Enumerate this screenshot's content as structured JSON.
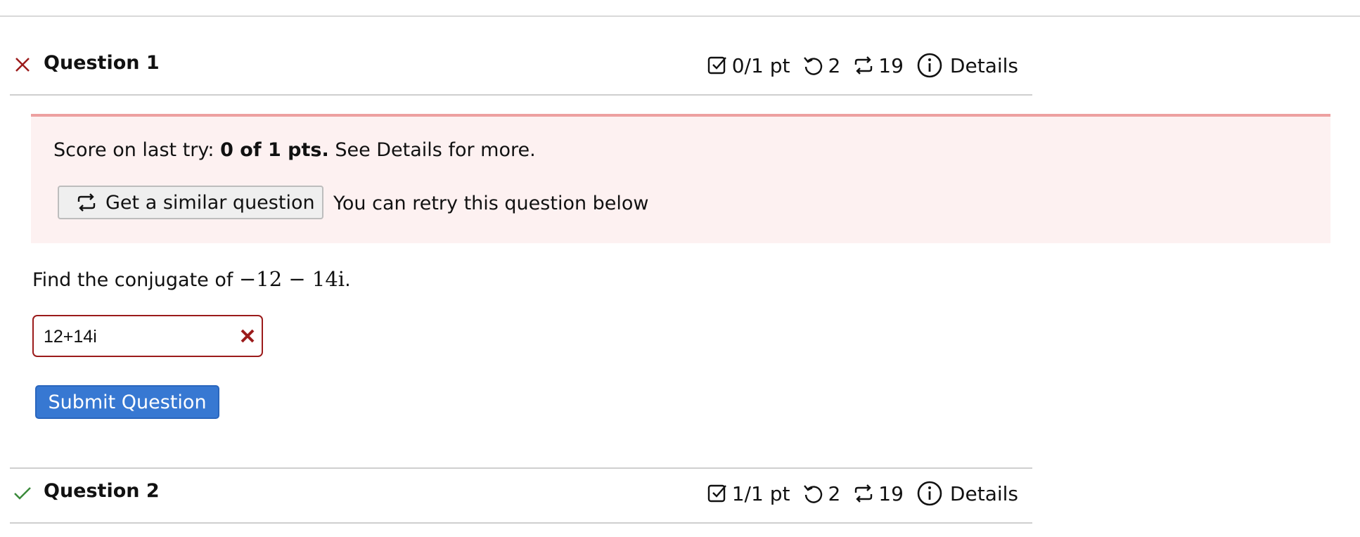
{
  "questions": [
    {
      "title": "Question 1",
      "status": "incorrect",
      "status_icon": "x-icon",
      "status_color": "#9b1b1b",
      "score": "0/1 pt",
      "retries": "2",
      "similar_count": "19",
      "details_label": "Details"
    },
    {
      "title": "Question 2",
      "status": "correct",
      "status_icon": "check-icon",
      "status_color": "#3b8a3b",
      "score": "1/1 pt",
      "retries": "2",
      "similar_count": "19",
      "details_label": "Details"
    }
  ],
  "feedback": {
    "score_prefix": "Score on last try: ",
    "score_bold": "0 of 1 pts.",
    "score_suffix": " See Details for more.",
    "similar_button_label": "Get a similar question",
    "retry_note": "You can retry this question below",
    "background": "#fdf1f1",
    "border_color": "#eda0a0"
  },
  "problem": {
    "prompt_text": "Find the conjugate of ",
    "expression": "−12 − 14i",
    "end_punct": "."
  },
  "answer": {
    "value": "12+14i",
    "status_icon": "x-icon"
  },
  "submit_label": "Submit Question",
  "colors": {
    "accent": "#3778d2",
    "error": "#9b1b1b",
    "success": "#3b8a3b"
  }
}
